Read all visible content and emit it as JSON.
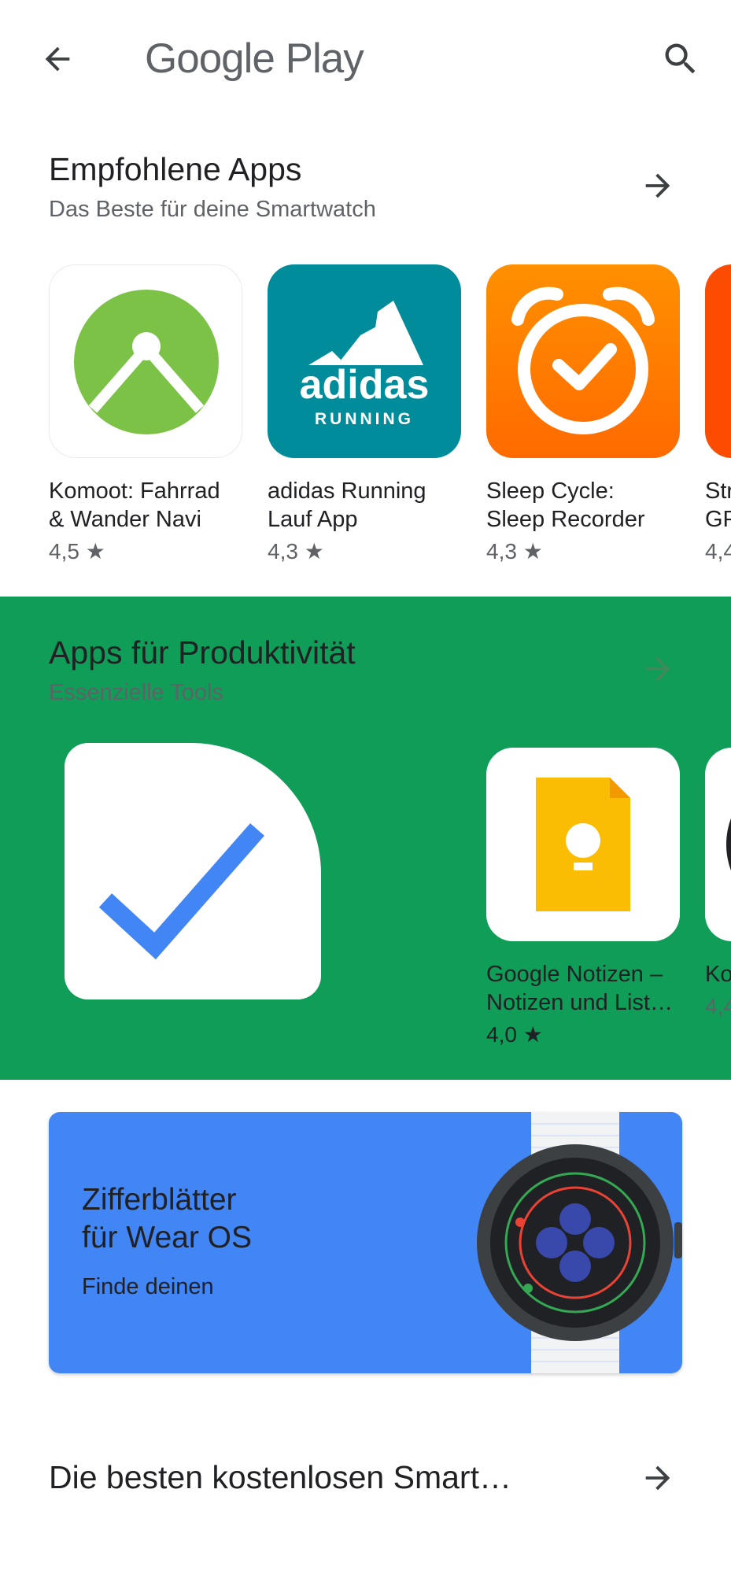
{
  "header": {
    "logo_text": "Google Play",
    "back_icon": "arrow-left-icon",
    "search_icon": "search-icon"
  },
  "section_recommended": {
    "title": "Empfohlene Apps",
    "subtitle": "Das Beste für deine Smartwatch",
    "apps": [
      {
        "name_line1": "Komoot: Fahrrad",
        "name_line2": "& Wander Navi",
        "rating": "4,5",
        "icon": "komoot-icon"
      },
      {
        "name_line1": "adidas Running",
        "name_line2": "Lauf App",
        "rating": "4,3",
        "icon": "adidas-running-icon",
        "icon_text": "adidas",
        "icon_subtext": "RUNNING"
      },
      {
        "name_line1": "Sleep Cycle:",
        "name_line2": "Sleep Recorder",
        "rating": "4,3",
        "icon": "sleep-cycle-icon"
      },
      {
        "name_line1": "Str",
        "name_line2": "GP",
        "rating": "4,4",
        "icon": "strava-icon"
      }
    ]
  },
  "section_productivity": {
    "title": "Apps für Produktivität",
    "subtitle": "Essenzielle Tools",
    "background": "#0f9d58",
    "apps": [
      {
        "name_line1": "Google Notizen –",
        "name_line2": "Notizen und List…",
        "rating": "4,0",
        "icon": "google-keep-icon"
      },
      {
        "name_line1": "Ko",
        "name_line2": "",
        "rating": "4,4",
        "icon": "watch-icon"
      }
    ]
  },
  "banner": {
    "title_line1": "Zifferblätter",
    "title_line2": "für Wear OS",
    "subtitle": "Finde deinen",
    "background": "#4285f4"
  },
  "section_free": {
    "title": "Die besten kostenlosen Smart…"
  },
  "colors": {
    "komoot_green": "#7bc247",
    "adidas_teal": "#008c9a",
    "sleep_orange": "#ff7a00",
    "keep_yellow": "#fbbc04",
    "check_blue": "#4285f4"
  }
}
